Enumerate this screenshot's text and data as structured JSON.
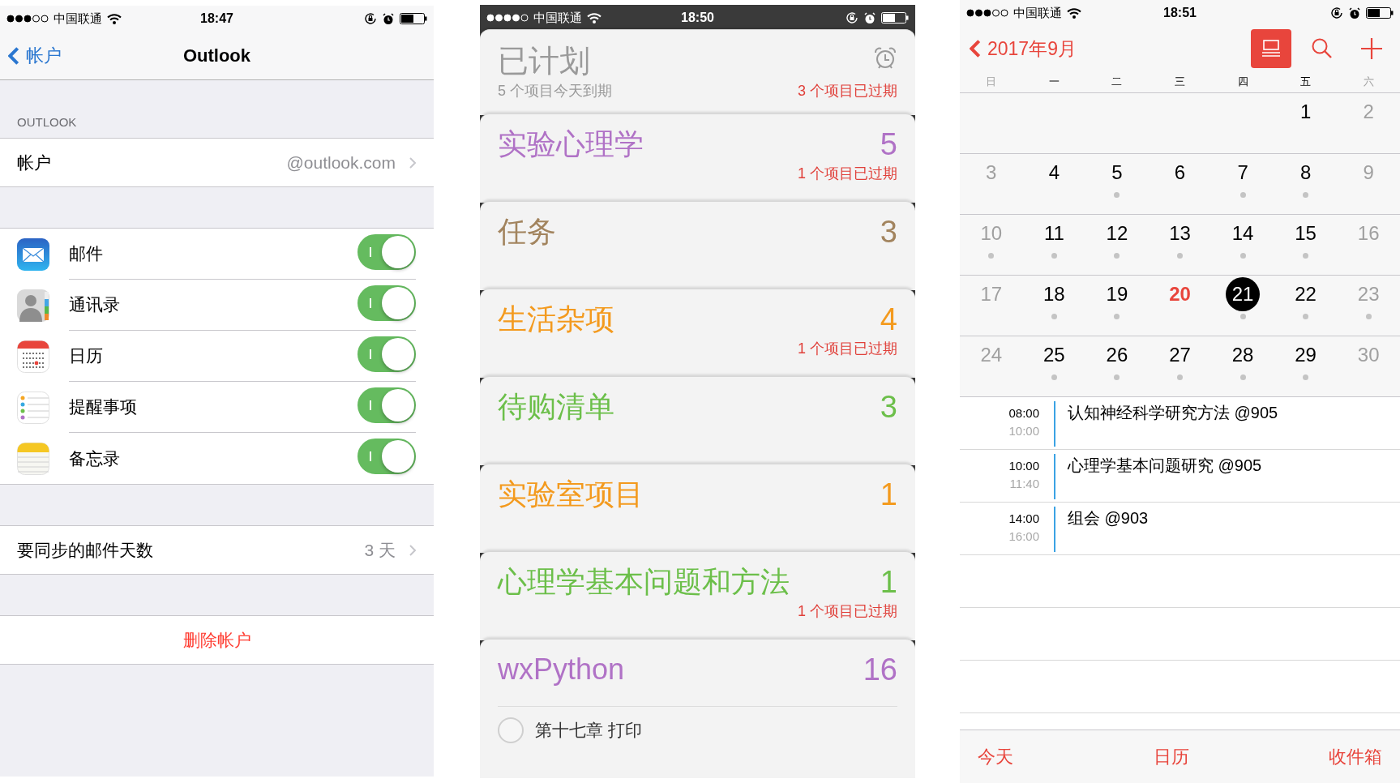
{
  "settings_screen": {
    "status_bar": {
      "carrier": "中国联通",
      "time": "18:47"
    },
    "nav": {
      "back": "帐户",
      "title": "Outlook"
    },
    "section_header": "OUTLOOK",
    "account_row": {
      "label": "帐户",
      "value": "@outlook.com"
    },
    "toggles": [
      {
        "kind": "mail",
        "label": "邮件",
        "on": true
      },
      {
        "kind": "contacts",
        "label": "通讯录",
        "on": true
      },
      {
        "kind": "calendar",
        "label": "日历",
        "on": true
      },
      {
        "kind": "reminders",
        "label": "提醒事项",
        "on": true
      },
      {
        "kind": "notes",
        "label": "备忘录",
        "on": true
      }
    ],
    "sync_row": {
      "label": "要同步的邮件天数",
      "value": "3 天"
    },
    "delete_button": "删除帐户"
  },
  "reminders_screen": {
    "status_bar": {
      "carrier": "中国联通",
      "time": "18:50"
    },
    "scheduled": {
      "title": "已计划",
      "due_today": "5 个项目今天到期",
      "overdue": "3 个项目已过期"
    },
    "lists": [
      {
        "name": "实验心理学",
        "count": "5",
        "color": "#b072c6",
        "overdue": "1 个项目已过期"
      },
      {
        "name": "任务",
        "count": "3",
        "color": "#a2845e"
      },
      {
        "name": "生活杂项",
        "count": "4",
        "color": "#f39a1e",
        "overdue": "1 个项目已过期"
      },
      {
        "name": "待购清单",
        "count": "3",
        "color": "#6cbf4a"
      },
      {
        "name": "实验室项目",
        "count": "1",
        "color": "#f39a1e"
      },
      {
        "name": "心理学基本问题和方法",
        "count": "1",
        "color": "#6cbf4a",
        "overdue": "1 个项目已过期"
      },
      {
        "name": "wxPython",
        "count": "16",
        "color": "#b072c6",
        "items": [
          {
            "text": "第十七章 打印",
            "checked": false
          }
        ]
      }
    ]
  },
  "calendar_screen": {
    "status_bar": {
      "carrier": "中国联通",
      "time": "18:51"
    },
    "month_title": "2017年9月",
    "weekdays": [
      {
        "label": "日",
        "weekend": true
      },
      {
        "label": "一",
        "weekend": false
      },
      {
        "label": "二",
        "weekend": false
      },
      {
        "label": "三",
        "weekend": false
      },
      {
        "label": "四",
        "weekend": false
      },
      {
        "label": "五",
        "weekend": false
      },
      {
        "label": "六",
        "weekend": true
      }
    ],
    "weeks": [
      [
        {
          "kind": "blank"
        },
        {
          "kind": "blank"
        },
        {
          "kind": "blank"
        },
        {
          "kind": "blank"
        },
        {
          "kind": "blank"
        },
        {
          "kind": "day",
          "day": "1",
          "weekend": false,
          "today": false,
          "selected": false,
          "has_event": false
        },
        {
          "kind": "day",
          "day": "2",
          "weekend": true,
          "today": false,
          "selected": false,
          "has_event": false
        }
      ],
      [
        {
          "kind": "day",
          "day": "3",
          "weekend": true,
          "today": false,
          "selected": false,
          "has_event": false
        },
        {
          "kind": "day",
          "day": "4",
          "weekend": false,
          "today": false,
          "selected": false,
          "has_event": false
        },
        {
          "kind": "day",
          "day": "5",
          "weekend": false,
          "today": false,
          "selected": false,
          "has_event": true
        },
        {
          "kind": "day",
          "day": "6",
          "weekend": false,
          "today": false,
          "selected": false,
          "has_event": false
        },
        {
          "kind": "day",
          "day": "7",
          "weekend": false,
          "today": false,
          "selected": false,
          "has_event": true
        },
        {
          "kind": "day",
          "day": "8",
          "weekend": false,
          "today": false,
          "selected": false,
          "has_event": true
        },
        {
          "kind": "day",
          "day": "9",
          "weekend": true,
          "today": false,
          "selected": false,
          "has_event": false
        }
      ],
      [
        {
          "kind": "day",
          "day": "10",
          "weekend": true,
          "today": false,
          "selected": false,
          "has_event": true
        },
        {
          "kind": "day",
          "day": "11",
          "weekend": false,
          "today": false,
          "selected": false,
          "has_event": true
        },
        {
          "kind": "day",
          "day": "12",
          "weekend": false,
          "today": false,
          "selected": false,
          "has_event": true
        },
        {
          "kind": "day",
          "day": "13",
          "weekend": false,
          "today": false,
          "selected": false,
          "has_event": true
        },
        {
          "kind": "day",
          "day": "14",
          "weekend": false,
          "today": false,
          "selected": false,
          "has_event": true
        },
        {
          "kind": "day",
          "day": "15",
          "weekend": false,
          "today": false,
          "selected": false,
          "has_event": true
        },
        {
          "kind": "day",
          "day": "16",
          "weekend": true,
          "today": false,
          "selected": false,
          "has_event": false
        }
      ],
      [
        {
          "kind": "day",
          "day": "17",
          "weekend": true,
          "today": false,
          "selected": false,
          "has_event": false
        },
        {
          "kind": "day",
          "day": "18",
          "weekend": false,
          "today": false,
          "selected": false,
          "has_event": true
        },
        {
          "kind": "day",
          "day": "19",
          "weekend": false,
          "today": false,
          "selected": false,
          "has_event": true
        },
        {
          "kind": "day",
          "day": "20",
          "weekend": false,
          "today": true,
          "selected": false,
          "has_event": false
        },
        {
          "kind": "day",
          "day": "21",
          "weekend": false,
          "today": false,
          "selected": true,
          "has_event": true
        },
        {
          "kind": "day",
          "day": "22",
          "weekend": false,
          "today": false,
          "selected": false,
          "has_event": true
        },
        {
          "kind": "day",
          "day": "23",
          "weekend": true,
          "today": false,
          "selected": false,
          "has_event": true
        }
      ],
      [
        {
          "kind": "day",
          "day": "24",
          "weekend": true,
          "today": false,
          "selected": false,
          "has_event": false
        },
        {
          "kind": "day",
          "day": "25",
          "weekend": false,
          "today": false,
          "selected": false,
          "has_event": true
        },
        {
          "kind": "day",
          "day": "26",
          "weekend": false,
          "today": false,
          "selected": false,
          "has_event": true
        },
        {
          "kind": "day",
          "day": "27",
          "weekend": false,
          "today": false,
          "selected": false,
          "has_event": true
        },
        {
          "kind": "day",
          "day": "28",
          "weekend": false,
          "today": false,
          "selected": false,
          "has_event": true
        },
        {
          "kind": "day",
          "day": "29",
          "weekend": false,
          "today": false,
          "selected": false,
          "has_event": true
        },
        {
          "kind": "day",
          "day": "30",
          "weekend": true,
          "today": false,
          "selected": false,
          "has_event": false
        }
      ]
    ],
    "events": [
      {
        "start": "08:00",
        "end": "10:00",
        "title": "认知神经科学研究方法 @905"
      },
      {
        "start": "10:00",
        "end": "11:40",
        "title": "心理学基本问题研究 @905"
      },
      {
        "start": "14:00",
        "end": "16:00",
        "title": "组会 @903"
      }
    ],
    "tabs": [
      "今天",
      "日历",
      "收件箱"
    ]
  }
}
